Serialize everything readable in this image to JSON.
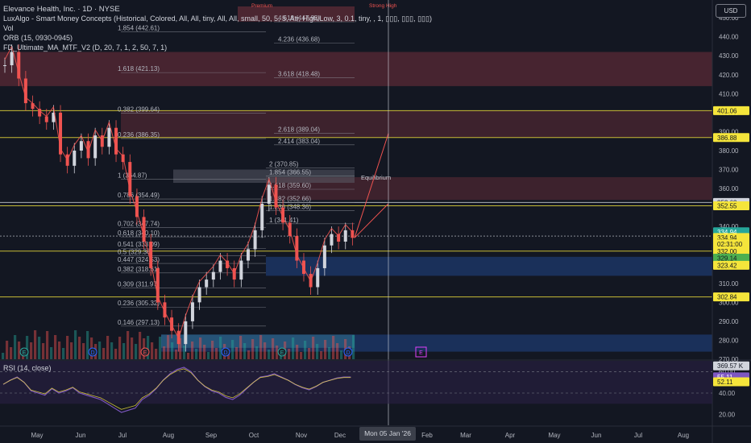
{
  "header": {
    "symbol": "Elevance Health, Inc. · 1D · NYSE",
    "indicator_1": "LuxAlgo - Smart Money Concepts (Historical, Colored, All, All, tiny, All, All, small, 50, 5, 5, Atr, High/Low, 3, 0.1, tiny, , 1, ▯▯▯, ▯▯▯, ▯▯▯)",
    "indicator_2": "Vol",
    "indicator_3": "ORB (15, 0930-0945)",
    "indicator_4": "FD_Ultimate_MA_MTF_V2 (D, 20, 7, 1, 2, 50, 7, 1)"
  },
  "currency_button": "USD",
  "rsi_label": "RSI (14, close)",
  "price_axis": {
    "ticks": [
      "450.00",
      "440.00",
      "430.00",
      "420.00",
      "410.00",
      "400.00",
      "390.00",
      "380.00",
      "370.00",
      "360.00",
      "350.00",
      "340.00",
      "330.00",
      "320.00",
      "310.00",
      "300.00",
      "290.00",
      "280.00",
      "270.00"
    ],
    "tick_values": [
      450,
      440,
      430,
      420,
      410,
      400,
      390,
      380,
      370,
      360,
      350,
      340,
      330,
      320,
      310,
      300,
      290,
      280,
      270
    ],
    "badges": [
      {
        "text": "401.06",
        "value": 401.06,
        "bg": "#f5e53b",
        "fg": "#131722"
      },
      {
        "text": "386.88",
        "value": 386.88,
        "bg": "#f5e53b",
        "fg": "#131722"
      },
      {
        "text": "352.63",
        "value": 352.63,
        "bg": "#d1d4dc",
        "fg": "#131722"
      },
      {
        "text": "352.55",
        "value": 350.9,
        "bg": "#f5e53b",
        "fg": "#131722"
      },
      {
        "text": "334.94",
        "value": 337.2,
        "bg": "#26a69a",
        "fg": "#ffffff"
      },
      {
        "text": "334.94",
        "value": 334.2,
        "bg": "#f5e53b",
        "fg": "#131722"
      },
      {
        "text": "02:31:00",
        "value": 330.8,
        "bg": "#f5e53b",
        "fg": "#131722"
      },
      {
        "text": "332.00",
        "value": 327.0,
        "bg": "#f5e53b",
        "fg": "#131722"
      },
      {
        "text": "329.14",
        "value": 323.3,
        "bg": "#4caf50",
        "fg": "#131722"
      },
      {
        "text": "323.42",
        "value": 319.5,
        "bg": "#f5e53b",
        "fg": "#131722"
      },
      {
        "text": "302.84",
        "value": 302.84,
        "bg": "#f5e53b",
        "fg": "#131722"
      },
      {
        "text": "369.57 K",
        "value": 266.5,
        "bg": "#d1d4dc",
        "fg": "#131722"
      }
    ]
  },
  "rsi_axis": {
    "ticks": [
      "60.00",
      "40.00",
      "20.00"
    ],
    "tick_values": [
      60,
      40,
      20
    ],
    "badges": [
      {
        "text": "55.11",
        "value": 55.11,
        "bg": "#7e57c2",
        "fg": "#ffffff"
      },
      {
        "text": "52.11",
        "value": 50.5,
        "bg": "#f5e53b",
        "fg": "#131722"
      }
    ]
  },
  "time_axis": {
    "labels": [
      "May",
      "Jun",
      "Jul",
      "Aug",
      "Sep",
      "Oct",
      "Nov",
      "Dec",
      "Feb",
      "Mar",
      "Apr",
      "May",
      "Jun",
      "Jul",
      "Aug"
    ],
    "crosshair": "Mon 05 Jan '26"
  },
  "fib_left": [
    {
      "label": "1.854 (442.61)",
      "value": 442.61
    },
    {
      "label": "1.618 (421.13)",
      "value": 421.13
    },
    {
      "label": "0.382 (399.64)",
      "value": 399.64
    },
    {
      "label": "0.236 (386.35)",
      "value": 386.35
    },
    {
      "label": "1 (364.87)",
      "value": 364.87
    },
    {
      "label": "0.786 (354.49)",
      "value": 354.49
    },
    {
      "label": "0.702 (347.74)",
      "value": 339.5
    },
    {
      "label": "0.618 (340.10)",
      "value": 334.5
    },
    {
      "label": "0.541 (333.09)",
      "value": 328.5
    },
    {
      "label": "0.5 (329.36)",
      "value": 324.5
    },
    {
      "label": "0.447 (324.53)",
      "value": 320.5
    },
    {
      "label": "0.382 (318.61)",
      "value": 315.5
    },
    {
      "label": "0.309 (311.97)",
      "value": 307.5
    },
    {
      "label": "0.236 (305.32)",
      "value": 297.5
    },
    {
      "label": "0.146 (297.13)",
      "value": 287.5
    }
  ],
  "fib_top": [
    {
      "label": "4.618 (447.92)",
      "value": 447.92
    },
    {
      "label": "4.236 (436.68)",
      "value": 436.68
    },
    {
      "label": "3.618 (418.48)",
      "value": 418.48
    },
    {
      "label": "2.618 (389.04)",
      "value": 389.04
    },
    {
      "label": "2.414 (383.04)",
      "value": 383.04
    }
  ],
  "fib_mid": [
    {
      "label": "2 (370.85)",
      "value": 370.85
    },
    {
      "label": "1.854 (366.55)",
      "value": 366.55
    },
    {
      "label": "1.618 (359.60)",
      "value": 359.6
    },
    {
      "label": "1.382 (352.66)",
      "value": 352.66
    },
    {
      "label": "1.236 (348.36)",
      "value": 348.36
    },
    {
      "label": "1 (341.41)",
      "value": 341.41
    }
  ],
  "chart_labels": {
    "equilibrium": "Equilibrium",
    "premium": "Premium",
    "strong_high": "Strong High"
  },
  "chart_data": {
    "type": "line",
    "title": "Elevance Health, Inc. · 1D · NYSE",
    "ylim": [
      270,
      456
    ],
    "close_series": [
      {
        "t": 0,
        "c": 425
      },
      {
        "t": 1,
        "c": 432
      },
      {
        "t": 2,
        "c": 418
      },
      {
        "t": 3,
        "c": 405
      },
      {
        "t": 4,
        "c": 402
      },
      {
        "t": 5,
        "c": 398
      },
      {
        "t": 6,
        "c": 395
      },
      {
        "t": 7,
        "c": 400
      },
      {
        "t": 8,
        "c": 378
      },
      {
        "t": 9,
        "c": 372
      },
      {
        "t": 10,
        "c": 380
      },
      {
        "t": 11,
        "c": 385
      },
      {
        "t": 12,
        "c": 376
      },
      {
        "t": 13,
        "c": 388
      },
      {
        "t": 14,
        "c": 382
      },
      {
        "t": 15,
        "c": 392
      },
      {
        "t": 16,
        "c": 378
      },
      {
        "t": 17,
        "c": 374
      },
      {
        "t": 18,
        "c": 356
      },
      {
        "t": 19,
        "c": 345
      },
      {
        "t": 20,
        "c": 332
      },
      {
        "t": 21,
        "c": 318
      },
      {
        "t": 22,
        "c": 300
      },
      {
        "t": 23,
        "c": 292
      },
      {
        "t": 24,
        "c": 285
      },
      {
        "t": 25,
        "c": 278
      },
      {
        "t": 26,
        "c": 290
      },
      {
        "t": 27,
        "c": 300
      },
      {
        "t": 28,
        "c": 308
      },
      {
        "t": 29,
        "c": 312
      },
      {
        "t": 30,
        "c": 316
      },
      {
        "t": 31,
        "c": 322
      },
      {
        "t": 32,
        "c": 318
      },
      {
        "t": 33,
        "c": 312
      },
      {
        "t": 34,
        "c": 322
      },
      {
        "t": 35,
        "c": 328
      },
      {
        "t": 36,
        "c": 338
      },
      {
        "t": 37,
        "c": 352
      },
      {
        "t": 38,
        "c": 362
      },
      {
        "t": 39,
        "c": 350
      },
      {
        "t": 40,
        "c": 342
      },
      {
        "t": 41,
        "c": 335
      },
      {
        "t": 42,
        "c": 322
      },
      {
        "t": 43,
        "c": 315
      },
      {
        "t": 44,
        "c": 308
      },
      {
        "t": 45,
        "c": 318
      },
      {
        "t": 46,
        "c": 330
      },
      {
        "t": 47,
        "c": 336
      },
      {
        "t": 48,
        "c": 332
      },
      {
        "t": 49,
        "c": 338
      },
      {
        "t": 50,
        "c": 334
      }
    ],
    "rsi_series": [
      48,
      52,
      55,
      50,
      42,
      40,
      38,
      44,
      40,
      42,
      45,
      40,
      38,
      36,
      34,
      30,
      26,
      22,
      24,
      26,
      34,
      38,
      44,
      52,
      58,
      62,
      64,
      60,
      52,
      46,
      42,
      40,
      36,
      34,
      38,
      44,
      50,
      55,
      56,
      58,
      55,
      52,
      48,
      45,
      43,
      46,
      50,
      52,
      54,
      55,
      55
    ]
  }
}
